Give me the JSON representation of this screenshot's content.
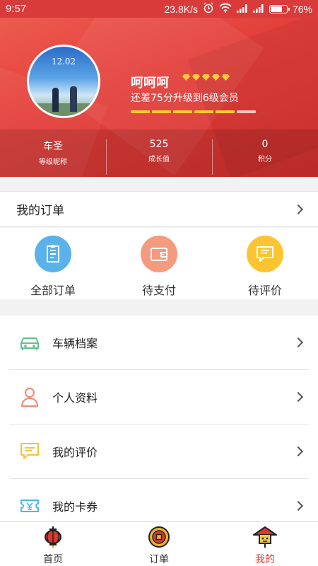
{
  "status_bar": {
    "time": "9:57",
    "network_speed": "23.8K/s",
    "battery": "76%",
    "battery_level": 0.76,
    "icons": [
      "alarm-icon",
      "wifi-icon",
      "signal-icon",
      "signal-icon",
      "battery-icon"
    ]
  },
  "profile": {
    "avatar_caption_line1": "12.02",
    "username": "呵呵呵",
    "diamond_count": 5,
    "level_message": "还差75分升级到6级会员",
    "progress_total": 6,
    "progress_filled": 5,
    "colors": {
      "header": "#e4403b",
      "accent": "#ffcc2e"
    }
  },
  "stats": [
    {
      "value": "车圣",
      "label": "等级昵称"
    },
    {
      "value": "525",
      "label": "成长值"
    },
    {
      "value": "0",
      "label": "积分"
    }
  ],
  "orders": {
    "title": "我的订单",
    "statuses": [
      {
        "label": "全部订单",
        "icon": "order-list-icon",
        "color": "#5ab2e8"
      },
      {
        "label": "待支付",
        "icon": "wallet-icon",
        "color": "#f59a7e"
      },
      {
        "label": "待评价",
        "icon": "comment-icon",
        "color": "#fbc531"
      }
    ]
  },
  "menu": [
    {
      "label": "车辆档案",
      "icon": "car-icon",
      "color": "#5fc38a"
    },
    {
      "label": "个人资料",
      "icon": "person-icon",
      "color": "#f08870"
    },
    {
      "label": "我的评价",
      "icon": "comment-icon",
      "color": "#f3c43b"
    },
    {
      "label": "我的卡券",
      "icon": "coupon-icon",
      "color": "#4bb8e8"
    }
  ],
  "bottom_nav": [
    {
      "label": "首页",
      "icon": "lantern-icon",
      "active": false
    },
    {
      "label": "订单",
      "icon": "coin-icon",
      "active": false
    },
    {
      "label": "我的",
      "icon": "hat-icon",
      "active": true
    }
  ]
}
